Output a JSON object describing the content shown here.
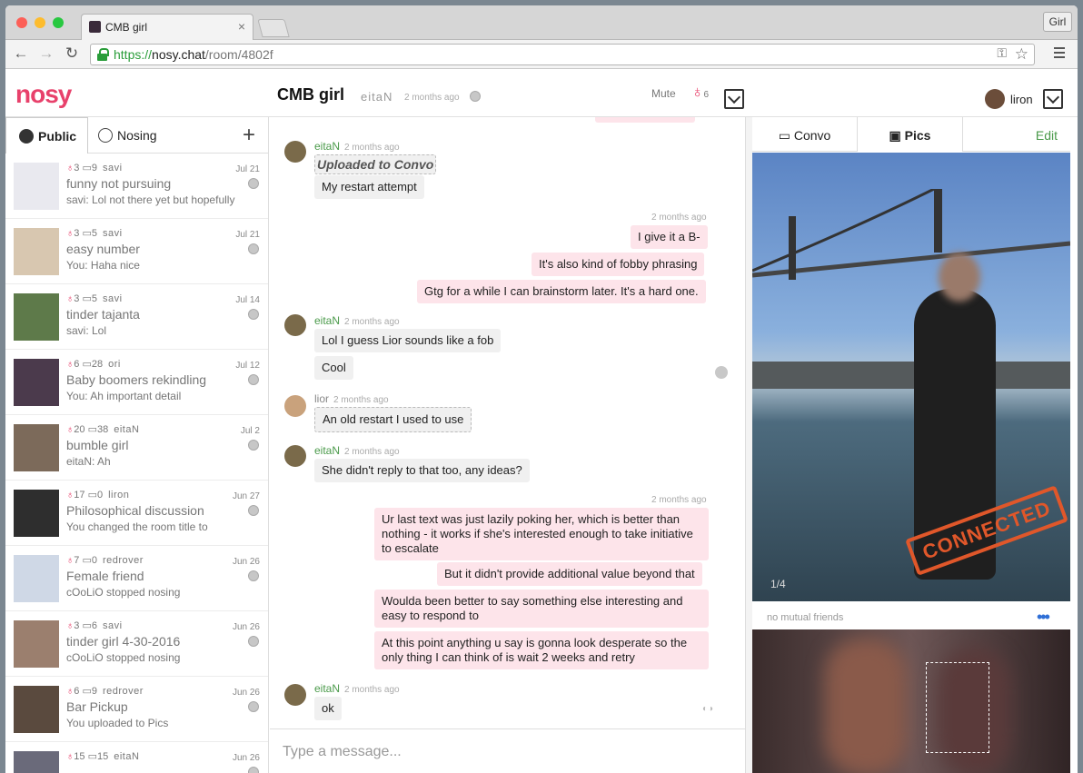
{
  "browser": {
    "tab_title": "CMB girl",
    "profile_label": "Girl",
    "url_scheme": "https://",
    "url_host": "nosy.chat",
    "url_path": "/room/4802f"
  },
  "app": {
    "logo": "nosy",
    "room_title": "CMB girl",
    "room_owner": "eitaN",
    "room_time": "2 months ago",
    "mute_label": "Mute",
    "nose_count": "6",
    "user_name": "liron",
    "accent_color": "#e8416b"
  },
  "sidebar": {
    "tab_public": "Public",
    "tab_nosing": "Nosing",
    "rooms": [
      {
        "noses": "3",
        "comments": "9",
        "who": "savi",
        "date": "Jul 21",
        "title": "funny not pursuing",
        "last": "savi: Lol not there yet but hopefully"
      },
      {
        "noses": "3",
        "comments": "5",
        "who": "savi",
        "date": "Jul 21",
        "title": "easy number",
        "last": "You: Haha nice"
      },
      {
        "noses": "3",
        "comments": "5",
        "who": "savi",
        "date": "Jul 14",
        "title": "tinder tajanta",
        "last": "savi: Lol"
      },
      {
        "noses": "6",
        "comments": "28",
        "who": "ori",
        "date": "Jul 12",
        "title": "Baby boomers rekindling",
        "last": "You: Ah important detail"
      },
      {
        "noses": "20",
        "comments": "38",
        "who": "eitaN",
        "date": "Jul 2",
        "title": "bumble girl",
        "last": "eitaN: Ah"
      },
      {
        "noses": "17",
        "comments": "0",
        "who": "liron",
        "date": "Jun 27",
        "title": "Philosophical discussion",
        "last": "You changed the room title to"
      },
      {
        "noses": "7",
        "comments": "0",
        "who": "redrover",
        "date": "Jun 26",
        "title": "Female friend",
        "last": "cOoLiO stopped nosing"
      },
      {
        "noses": "3",
        "comments": "6",
        "who": "savi",
        "date": "Jun 26",
        "title": "tinder girl 4-30-2016",
        "last": "cOoLiO stopped nosing"
      },
      {
        "noses": "6",
        "comments": "9",
        "who": "redrover",
        "date": "Jun 26",
        "title": "Bar Pickup",
        "last": "You uploaded to Pics"
      },
      {
        "noses": "15",
        "comments": "15",
        "who": "eitaN",
        "date": "Jun 26",
        "title": "",
        "last": ""
      }
    ]
  },
  "chat": {
    "m1_sender": "eitaN",
    "m1_time": "2 months ago",
    "m1_upload": "Uploaded to Convo",
    "m1_text": "My restart attempt",
    "o1_time": "2 months ago",
    "o1_a": "I give it a B-",
    "o1_b": "It's also kind of fobby phrasing",
    "o1_c": "Gtg for a while I can brainstorm later. It's a hard one.",
    "m2_sender": "eitaN",
    "m2_time": "2 months ago",
    "m2_a": "Lol I guess Lior sounds like a fob",
    "m2_b": "Cool",
    "m3_sender": "lior",
    "m3_time": "2 months ago",
    "m3_text": "An old restart I used to use",
    "m4_sender": "eitaN",
    "m4_time": "2 months ago",
    "m4_text": "She didn't reply to that too, any ideas?",
    "o2_time": "2 months ago",
    "o2_a": "Ur last text was just lazily poking her, which is better than nothing - it works if she's interested enough to take initiative to escalate",
    "o2_b": "But it didn't provide additional value beyond that",
    "o2_c": "Woulda been better to say something else interesting and easy to respond to",
    "o2_d": "At this point anything u say is gonna look desperate so the only thing I can think of is wait 2 weeks and retry",
    "m5_sender": "eitaN",
    "m5_time": "2 months ago",
    "m5_text": "ok",
    "composer_placeholder": "Type a message..."
  },
  "right": {
    "tab_convo": "Convo",
    "tab_pics": "Pics",
    "edit_label": "Edit",
    "stamp": "CONNECTED",
    "photo_count": "1/4",
    "mutual": "no mutual friends",
    "more": "•••"
  }
}
